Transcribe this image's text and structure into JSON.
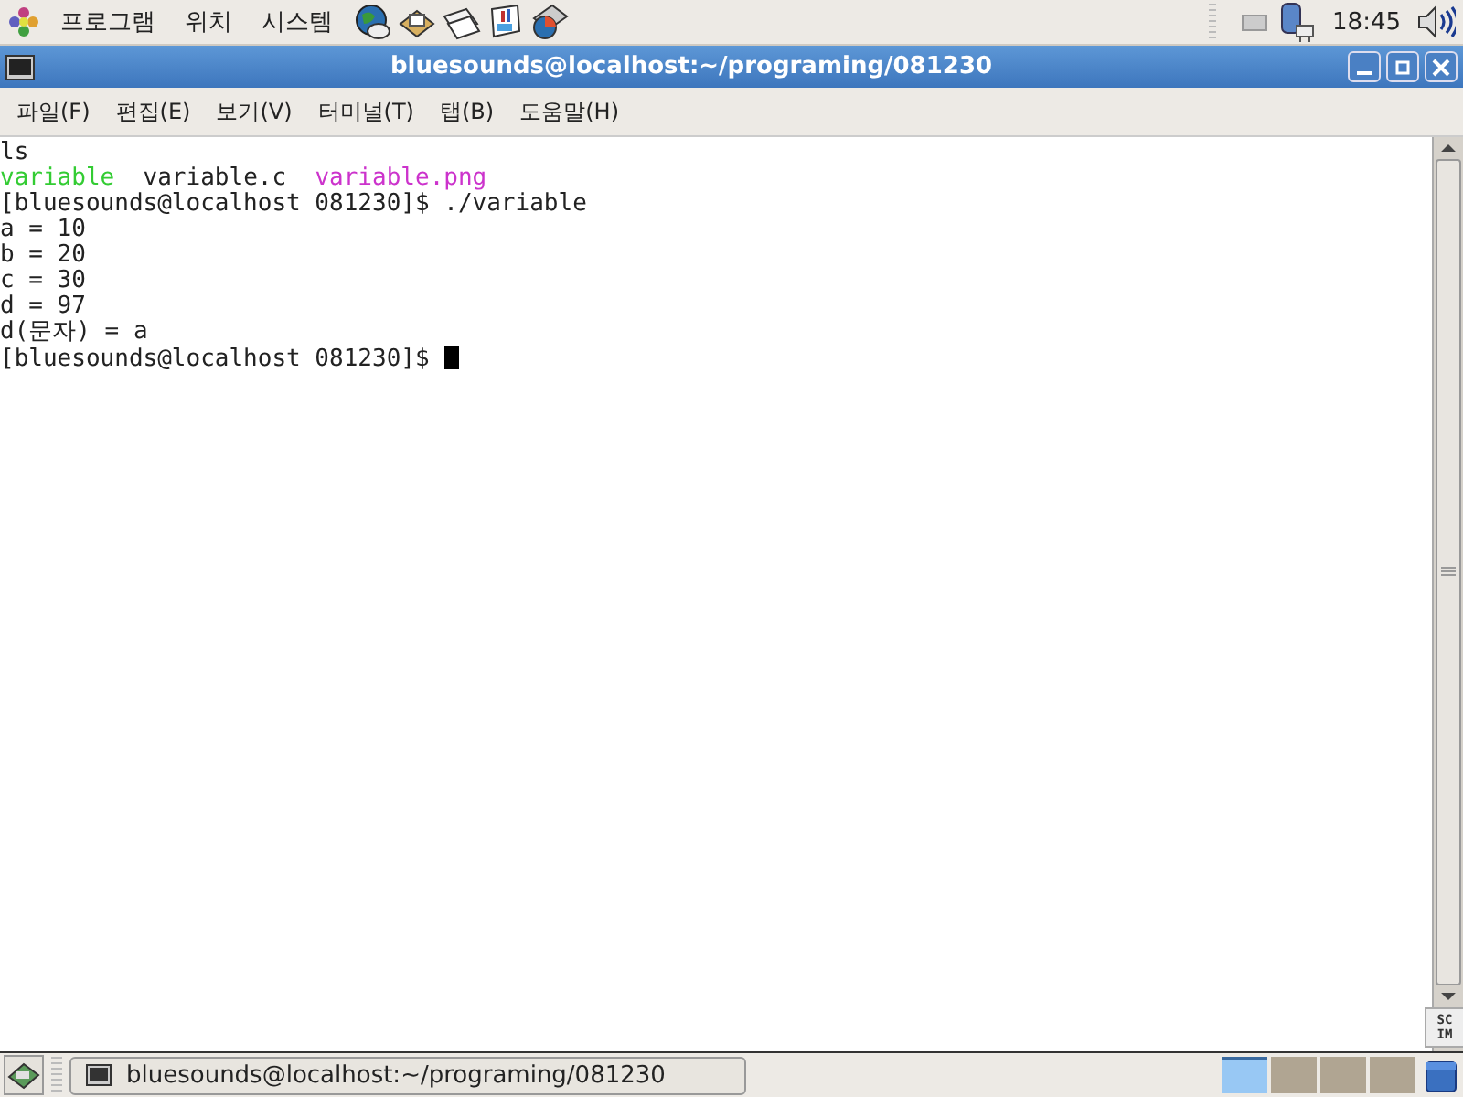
{
  "top_panel": {
    "menus": [
      "프로그램",
      "위치",
      "시스템"
    ],
    "clock": "18:45"
  },
  "window": {
    "title": "bluesounds@localhost:~/programing/081230"
  },
  "menubar": [
    "파일(F)",
    "편집(E)",
    "보기(V)",
    "터미널(T)",
    "탭(B)",
    "도움말(H)"
  ],
  "terminal": {
    "lines": [
      [
        {
          "text": "ls"
        }
      ],
      [
        {
          "text": "variable",
          "color": "#33cc33"
        },
        {
          "text": "  variable.c  "
        },
        {
          "text": "variable.png",
          "color": "#cc33cc"
        }
      ],
      [
        {
          "text": "[bluesounds@localhost 081230]$ ./variable"
        }
      ],
      [
        {
          "text": "a = 10"
        }
      ],
      [
        {
          "text": "b = 20"
        }
      ],
      [
        {
          "text": "c = 30"
        }
      ],
      [
        {
          "text": "d = 97"
        }
      ],
      [
        {
          "text": "d(문자) = a"
        }
      ],
      [
        {
          "text": "[bluesounds@localhost 081230]$ "
        }
      ]
    ],
    "cursor": true
  },
  "input_indicator": [
    "SC",
    "IM"
  ],
  "taskbar": {
    "tasks": [
      {
        "label": "bluesounds@localhost:~/programing/081230",
        "selected": false
      }
    ],
    "workspaces": [
      {
        "selected": true
      },
      {
        "selected": false
      },
      {
        "selected": false
      },
      {
        "selected": false
      }
    ]
  }
}
